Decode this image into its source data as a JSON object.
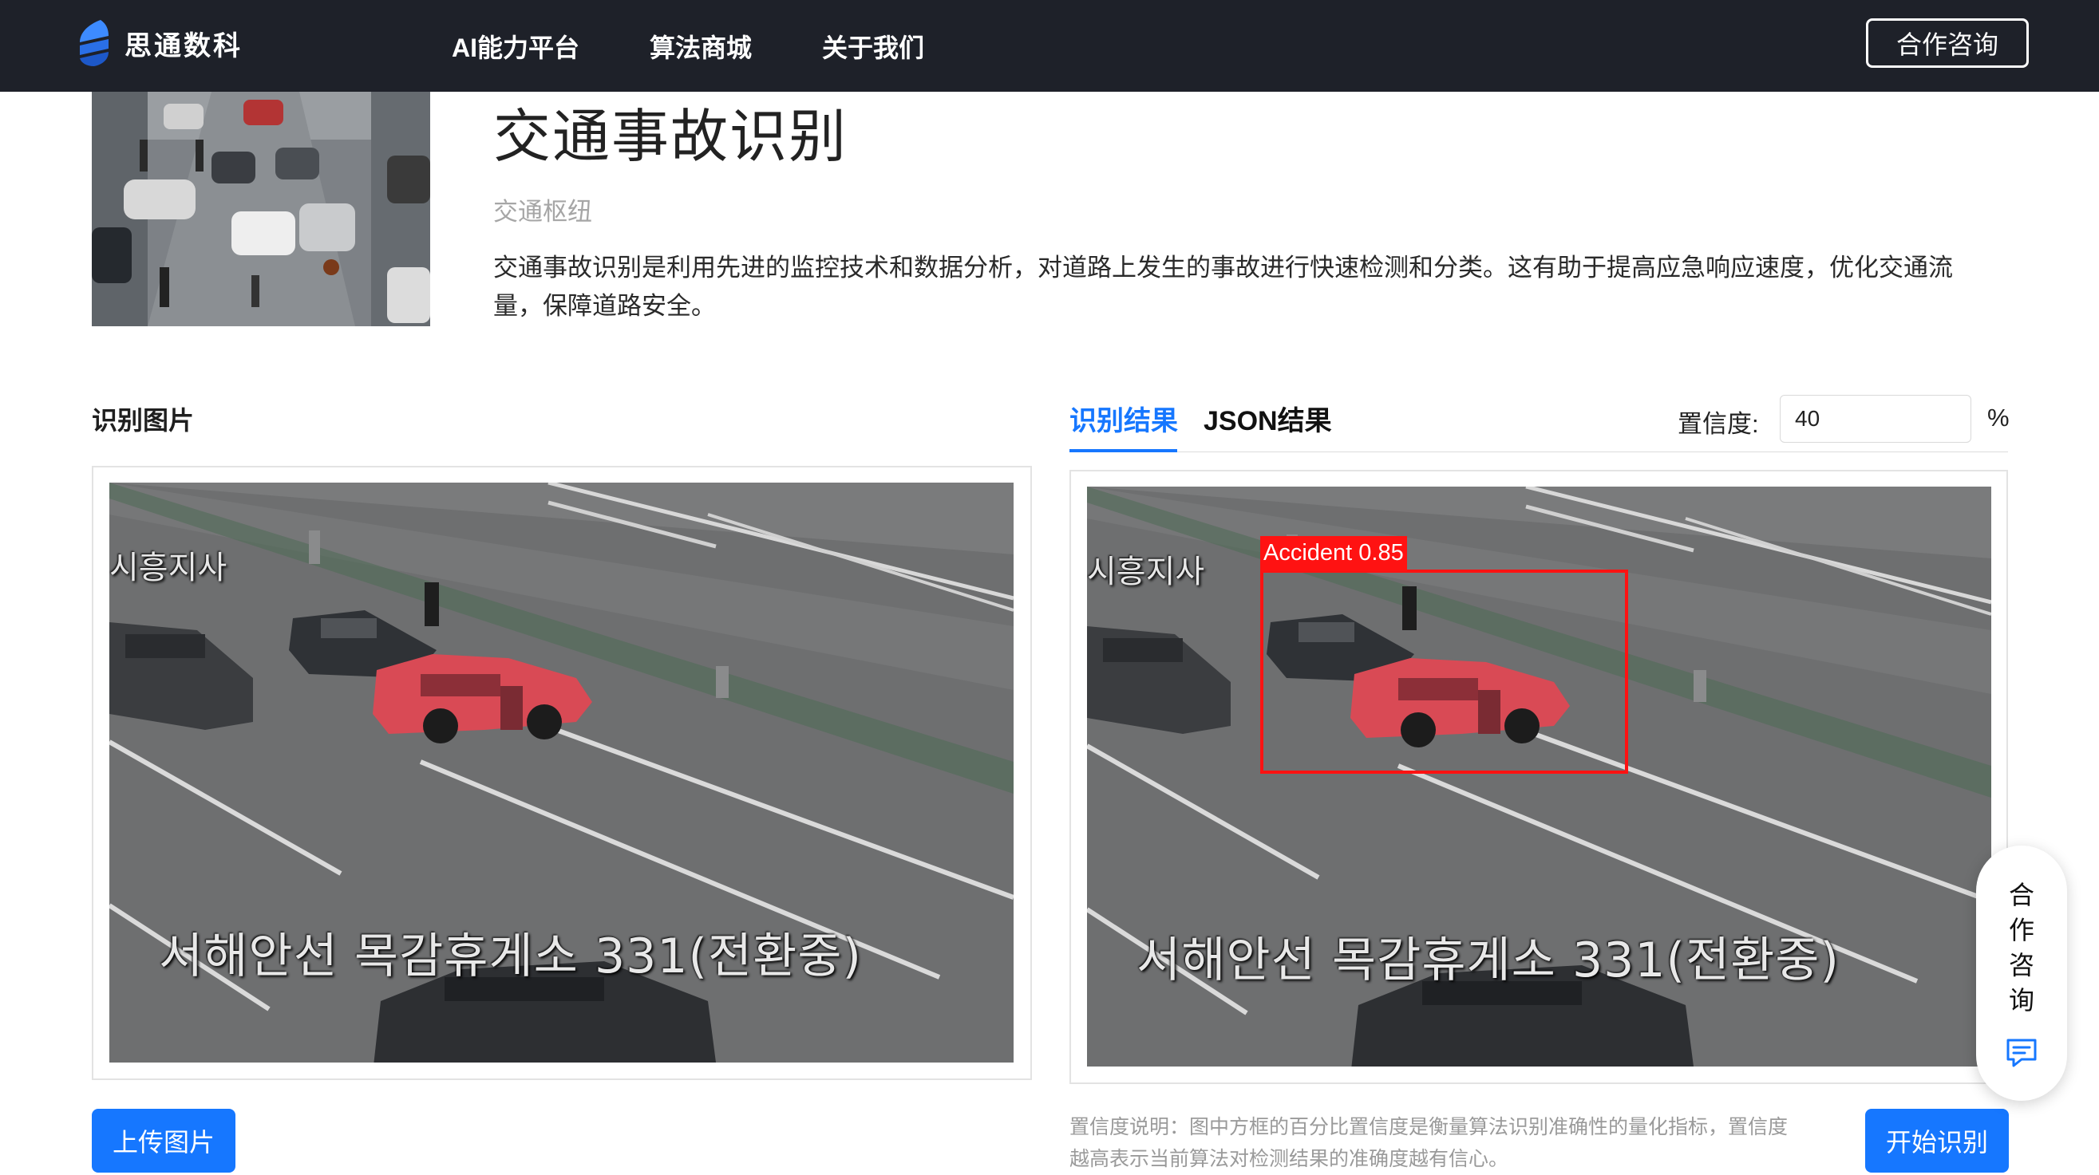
{
  "nav": {
    "brand": "思通数科",
    "items": [
      "AI能力平台",
      "算法商城",
      "关于我们"
    ],
    "consult_label": "合作咨询"
  },
  "hero": {
    "title": "交通事故识别",
    "category": "交通枢纽",
    "description": "交通事故识别是利用先进的监控技术和数据分析，对道路上发生的事故进行快速检测和分类。这有助于提高应急响应速度，优化交通流量，保障道路安全。"
  },
  "left_panel": {
    "label": "识别图片",
    "upload_label": "上传图片"
  },
  "right_panel": {
    "tabs": [
      "识别结果",
      "JSON结果"
    ],
    "active_tab": "识别结果",
    "confidence_label": "置信度:",
    "confidence_value": "40",
    "confidence_unit": "%",
    "start_label": "开始识别",
    "note": "置信度说明：图中方框的百分比置信度是衡量算法识别准确性的量化指标，置信度越高表示当前算法对检测结果的准确度越有信心。"
  },
  "image_overlay": {
    "top_text": "시흥지사",
    "bottom_text": "서해안선  목감휴게소  331(전환중)"
  },
  "detection": {
    "label": "Accident 0.85",
    "class": "Accident",
    "score": 0.85,
    "color": "#ff1212"
  },
  "float_widget": {
    "label": "合作咨询",
    "icon": "chat-icon"
  },
  "colors": {
    "accent": "#1677ff",
    "nav_bg": "#1e2129"
  }
}
